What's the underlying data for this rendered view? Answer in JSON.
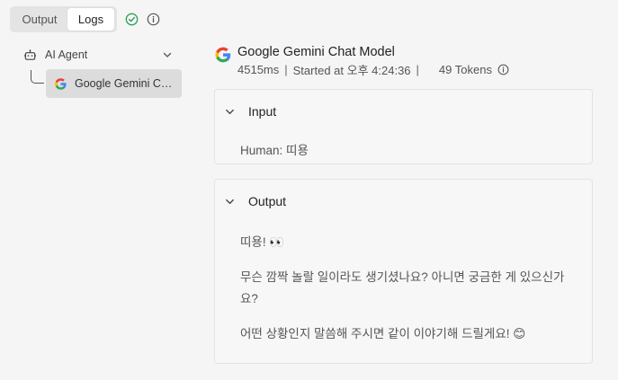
{
  "tabs": {
    "output_label": "Output",
    "logs_label": "Logs",
    "active": "Logs"
  },
  "status": {
    "icon": "check-circle-icon",
    "color": "#2e9d5b"
  },
  "tree": {
    "agent_label": "AI Agent",
    "child_label": "Google Gemini Chat Model"
  },
  "detail": {
    "title": "Google Gemini Chat Model",
    "duration": "4515ms",
    "started": "Started at 오후 4:24:36",
    "tokens": "49 Tokens"
  },
  "input": {
    "label": "Input",
    "text": "Human: 띠용"
  },
  "output": {
    "label": "Output",
    "line1": "띠용! 👀",
    "line2": "무슨 깜짝 놀랄 일이라도 생기셨나요? 아니면 궁금한 게 있으신가요?",
    "line3": "어떤 상황인지 말씀해 주시면 같이 이야기해 드릴게요! 😊"
  }
}
